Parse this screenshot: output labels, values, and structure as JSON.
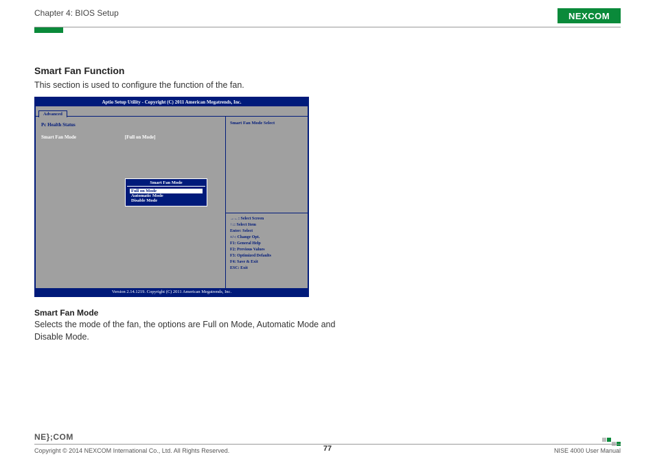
{
  "header": {
    "chapter": "Chapter 4: BIOS Setup",
    "logo": "NEXCOM"
  },
  "section": {
    "title": "Smart Fan Function",
    "desc": "This section is used to configure the function of the fan."
  },
  "bios": {
    "titlebar": "Aptio Setup Utility - Copyright (C) 2011 American Megatrends, Inc.",
    "tab": "Advanced",
    "left_heading": "Pc Health Status",
    "sfm_label": "Smart Fan Mode",
    "sfm_val": "[Full on Mode]",
    "popup_title": "Smart Fan Mode",
    "popup_options": [
      "Full on Mode",
      "Automatic Mode",
      "Disable Mode"
    ],
    "right_title": "Smart Fan Mode Select",
    "help": [
      "→←: Select Screen",
      "↑↓: Select Item",
      "Enter: Select",
      "+/-: Change Opt.",
      "F1: General Help",
      "F2: Previous Values",
      "F3: Optimized Defaults",
      "F4: Save & Exit",
      "ESC: Exit"
    ],
    "footer": "Version 2.14.1219. Copyright (C) 2011 American Megatrends, Inc."
  },
  "sub": {
    "title": "Smart Fan Mode",
    "desc": "Selects the mode of the fan, the options are Full on Mode, Automatic Mode and Disable Mode."
  },
  "footer": {
    "copyright": "Copyright © 2014 NEXCOM International Co., Ltd. All Rights Reserved.",
    "page": "77",
    "manual": "NISE 4000 User Manual",
    "logo": "NE};COM"
  }
}
